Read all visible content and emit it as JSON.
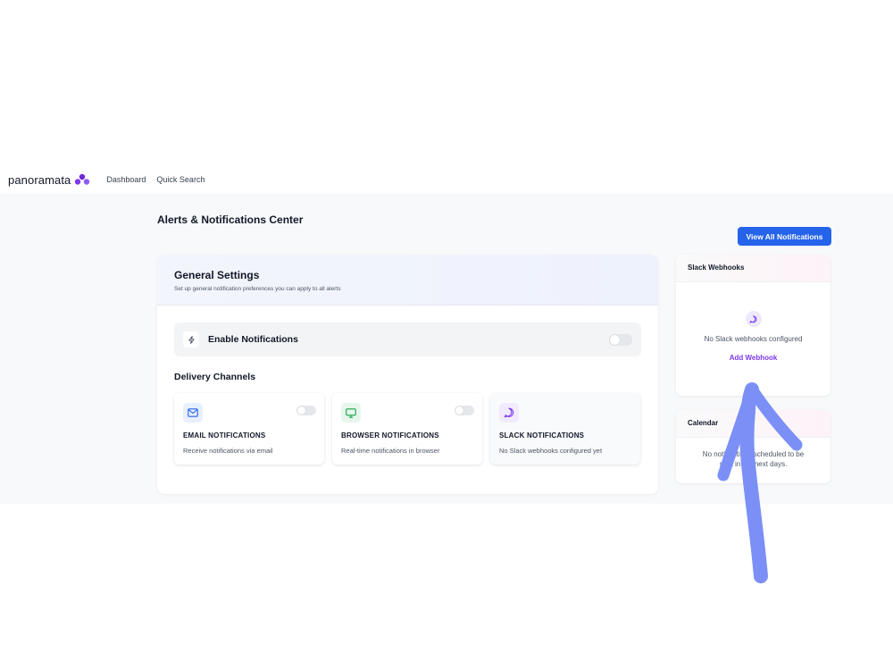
{
  "nav": {
    "brand": "panoramata",
    "links": [
      "Dashboard",
      "Quick Search"
    ]
  },
  "page": {
    "title": "Alerts & Notifications Center",
    "view_all_label": "View All Notifications"
  },
  "general": {
    "title": "General Settings",
    "subtitle": "Set up general notification preferences you can apply to all alerts",
    "enable_label": "Enable Notifications",
    "enable_on": false,
    "delivery_title": "Delivery Channels",
    "channels": [
      {
        "title": "EMAIL NOTIFICATIONS",
        "desc": "Receive notifications via email",
        "icon": "mail-icon",
        "color": "#2563eb",
        "bg": "#e8effd",
        "on": false
      },
      {
        "title": "BROWSER NOTIFICATIONS",
        "desc": "Real-time notifications in browser",
        "icon": "monitor-icon",
        "color": "#16a34a",
        "bg": "#e7f6ec",
        "on": false
      },
      {
        "title": "SLACK NOTIFICATIONS",
        "desc": "No Slack webhooks configured yet",
        "icon": "chat-icon",
        "color": "#7c3aed",
        "bg": "#f1ebfd",
        "on": false
      }
    ]
  },
  "slack": {
    "title": "Slack Webhooks",
    "empty_text": "No Slack webhooks configured",
    "add_label": "Add Webhook",
    "icon": "chat-icon"
  },
  "calendar": {
    "title": "Calendar",
    "empty_line1": "No notifications scheduled to be",
    "empty_line2": "sent in the next days."
  },
  "colors": {
    "primary": "#2563eb",
    "accent": "#7c3aed",
    "annotation_arrow": "#7b8ff7"
  }
}
